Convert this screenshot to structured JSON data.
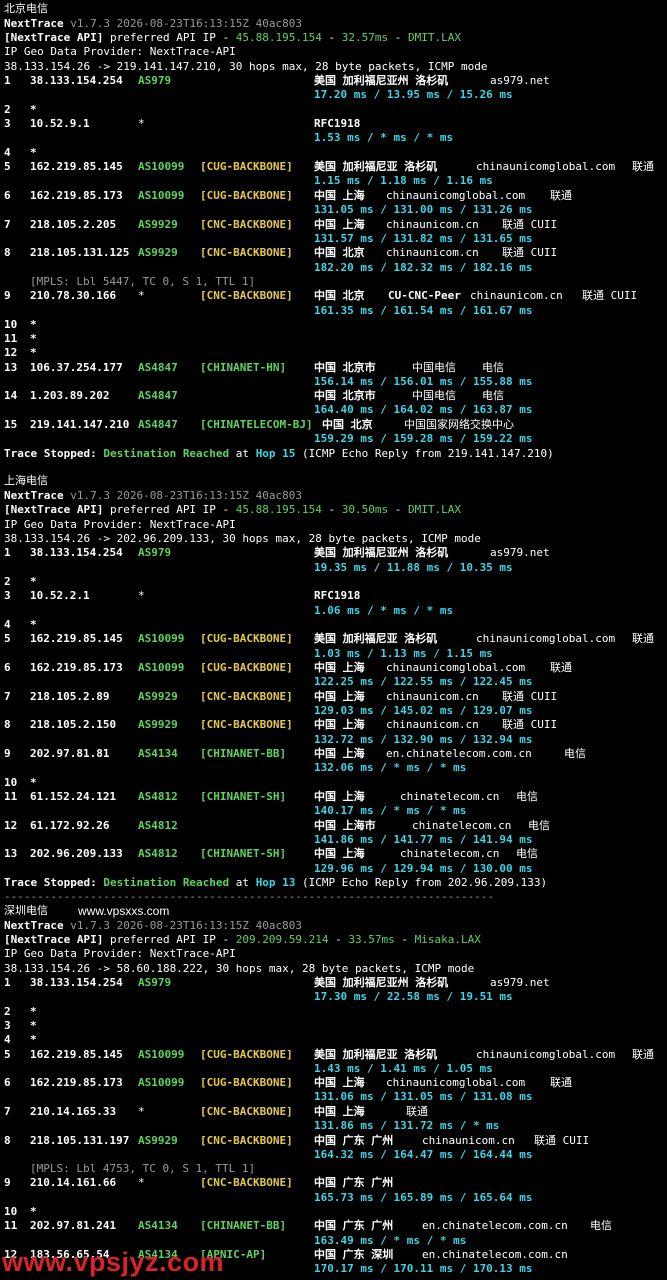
{
  "colors": {
    "background": "#000000",
    "white": "#ffffff",
    "gray": "#9a9a9a",
    "green": "#5fd35f",
    "yellow": "#e5c94a",
    "cyan": "#3fd4e6",
    "watermark": "#d9232a"
  },
  "s1": {
    "title": "北京电信",
    "app": "NextTrace",
    "version": "v1.7.3 2026-08-23T16:13:15Z 40ac803",
    "api_prefix": "[NextTrace API]",
    "api_mid": " preferred API IP - ",
    "api_ip": "45.88.195.154",
    "api_dash": " - ",
    "api_ms": "32.57ms",
    "api_dash2": " - ",
    "api_node": "DMIT.LAX",
    "geo": "IP Geo Data Provider: NextTrace-API",
    "route": "38.133.154.26 -> 219.141.147.210, 30 hops max, 28 byte packets, ICMP mode",
    "h1": {
      "n": "1",
      "ip": "38.133.154.254",
      "as": "AS979",
      "geo": "美国 加利福尼亚州 洛杉矶",
      "dom": "as979.net",
      "rtt": "17.20 ms / 13.95 ms / 15.26 ms"
    },
    "h2": {
      "n": "2",
      "ip": "*"
    },
    "h3": {
      "n": "3",
      "ip": "10.52.9.1",
      "as": "*",
      "geo": "RFC1918",
      "rtt": "1.53 ms / * ms / * ms"
    },
    "h4": {
      "n": "4",
      "ip": "*"
    },
    "h5": {
      "n": "5",
      "ip": "162.219.85.145",
      "as": "AS10099",
      "tag": "[CUG-BACKBONE]",
      "geo": "美国 加利福尼亚 洛杉矶",
      "dom": "chinaunicomglobal.com",
      "isp": "联通",
      "rtt": "1.15 ms / 1.18 ms / 1.16 ms"
    },
    "h6": {
      "n": "6",
      "ip": "162.219.85.173",
      "as": "AS10099",
      "tag": "[CUG-BACKBONE]",
      "geo": "中国 上海",
      "dom": "chinaunicomglobal.com",
      "isp": "联通",
      "rtt": "131.05 ms / 131.00 ms / 131.26 ms"
    },
    "h7": {
      "n": "7",
      "ip": "218.105.2.205",
      "as": "AS9929",
      "tag": "[CNC-BACKBONE]",
      "geo": "中国 上海",
      "dom": "chinaunicom.cn",
      "isp": "联通 CUII",
      "rtt": "131.57 ms / 131.82 ms / 131.65 ms"
    },
    "h8": {
      "n": "8",
      "ip": "218.105.131.125",
      "as": "AS9929",
      "tag": "[CNC-BACKBONE]",
      "geo": "中国 北京",
      "dom": "chinaunicom.cn",
      "isp": "联通 CUII",
      "rtt": "182.20 ms / 182.32 ms / 182.16 ms"
    },
    "mpls": "[MPLS: Lbl 5447, TC 0, S 1, TTL 1]",
    "h9": {
      "n": "9",
      "ip": "210.78.30.166",
      "as": "*",
      "tag": "[CNC-BACKBONE]",
      "geo": "中国 北京",
      "extra": "CU-CNC-Peer",
      "dom": "chinaunicom.cn",
      "isp": "联通 CUII",
      "rtt": "161.35 ms / 161.54 ms / 161.67 ms"
    },
    "h10": {
      "n": "10",
      "ip": "*"
    },
    "h11": {
      "n": "11",
      "ip": "*"
    },
    "h12": {
      "n": "12",
      "ip": "*"
    },
    "h13": {
      "n": "13",
      "ip": "106.37.254.177",
      "as": "AS4847",
      "tag": "[CHINANET-HN]",
      "geo": "中国 北京市",
      "dom": "中国电信",
      "isp": "电信",
      "rtt": "156.14 ms / 156.01 ms / 155.88 ms"
    },
    "h14": {
      "n": "14",
      "ip": "1.203.89.202",
      "as": "AS4847",
      "geo": "中国 北京市",
      "dom": "中国电信",
      "isp": "电信",
      "rtt": "164.40 ms / 164.02 ms / 163.87 ms"
    },
    "h15": {
      "n": "15",
      "ip": "219.141.147.210",
      "as": "AS4847",
      "tag": "[CHINATELECOM-BJ]",
      "geo": "中国 北京",
      "dom": "中国国家网络交换中心",
      "rtt": "159.29 ms / 159.28 ms / 159.22 ms"
    },
    "stop1": "Trace Stopped: ",
    "stop2": "Destination Reached",
    "stop3": " at ",
    "stop4": "Hop 15",
    "stop5": " (ICMP Echo Reply from 219.141.147.210)"
  },
  "s2": {
    "title": "上海电信",
    "app": "NextTrace",
    "version": "v1.7.3 2026-08-23T16:13:15Z 40ac803",
    "api_prefix": "[NextTrace API]",
    "api_mid": " preferred API IP - ",
    "api_ip": "45.88.195.154",
    "api_dash": " - ",
    "api_ms": "30.50ms",
    "api_dash2": " - ",
    "api_node": "DMIT.LAX",
    "geo": "IP Geo Data Provider: NextTrace-API",
    "route": "38.133.154.26 -> 202.96.209.133, 30 hops max, 28 byte packets, ICMP mode",
    "h1": {
      "n": "1",
      "ip": "38.133.154.254",
      "as": "AS979",
      "geo": "美国 加利福尼亚州 洛杉矶",
      "dom": "as979.net",
      "rtt": "19.35 ms / 11.88 ms / 10.35 ms"
    },
    "h2": {
      "n": "2",
      "ip": "*"
    },
    "h3": {
      "n": "3",
      "ip": "10.52.2.1",
      "as": "*",
      "geo": "RFC1918",
      "rtt": "1.06 ms / * ms / * ms"
    },
    "h4": {
      "n": "4",
      "ip": "*"
    },
    "h5": {
      "n": "5",
      "ip": "162.219.85.145",
      "as": "AS10099",
      "tag": "[CUG-BACKBONE]",
      "geo": "美国 加利福尼亚 洛杉矶",
      "dom": "chinaunicomglobal.com",
      "isp": "联通",
      "rtt": "1.03 ms / 1.13 ms / 1.15 ms"
    },
    "h6": {
      "n": "6",
      "ip": "162.219.85.173",
      "as": "AS10099",
      "tag": "[CUG-BACKBONE]",
      "geo": "中国 上海",
      "dom": "chinaunicomglobal.com",
      "isp": "联通",
      "rtt": "122.25 ms / 122.55 ms / 122.45 ms"
    },
    "h7": {
      "n": "7",
      "ip": "218.105.2.89",
      "as": "AS9929",
      "tag": "[CNC-BACKBONE]",
      "geo": "中国 上海",
      "dom": "chinaunicom.cn",
      "isp": "联通 CUII",
      "rtt": "129.03 ms / 145.02 ms / 129.07 ms"
    },
    "h8": {
      "n": "8",
      "ip": "218.105.2.150",
      "as": "AS9929",
      "tag": "[CNC-BACKBONE]",
      "geo": "中国 上海",
      "dom": "chinaunicom.cn",
      "isp": "联通 CUII",
      "rtt": "132.72 ms / 132.90 ms / 132.94 ms"
    },
    "h9": {
      "n": "9",
      "ip": "202.97.81.81",
      "as": "AS4134",
      "tag": "[CHINANET-BB]",
      "geo": "中国 上海",
      "dom": "en.chinatelecom.com.cn",
      "isp": "电信",
      "rtt": "132.06 ms / * ms / * ms"
    },
    "h10": {
      "n": "10",
      "ip": "*"
    },
    "h11": {
      "n": "11",
      "ip": "61.152.24.121",
      "as": "AS4812",
      "tag": "[CHINANET-SH]",
      "geo": "中国 上海",
      "dom": "chinatelecom.cn",
      "isp": "电信",
      "rtt": "140.17 ms / * ms / * ms"
    },
    "h12": {
      "n": "12",
      "ip": "61.172.92.26",
      "as": "AS4812",
      "geo": "中国 上海市",
      "dom": "chinatelecom.cn",
      "isp": "电信",
      "rtt": "141.86 ms / 141.77 ms / 141.94 ms"
    },
    "h13": {
      "n": "13",
      "ip": "202.96.209.133",
      "as": "AS4812",
      "tag": "[CHINANET-SH]",
      "geo": "中国 上海",
      "dom": "chinatelecom.cn",
      "isp": "电信",
      "rtt": "129.96 ms / 129.94 ms / 130.00 ms"
    },
    "stop1": "Trace Stopped: ",
    "stop2": "Destination Reached",
    "stop3": " at ",
    "stop4": "Hop 13",
    "stop5": " (ICMP Echo Reply from 202.96.209.133)"
  },
  "divider": "--------------------------------------------------------------------------",
  "s3": {
    "title": "深圳电信",
    "site": "www.vpsxxs.com",
    "app": "NextTrace",
    "version": "v1.7.3 2026-08-23T16:13:15Z 40ac803",
    "api_prefix": "[NextTrace API]",
    "api_mid": " preferred API IP - ",
    "api_ip": "209.209.59.214",
    "api_dash": " - ",
    "api_ms": "33.57ms",
    "api_dash2": " - ",
    "api_node": "Misaka.LAX",
    "geo": "IP Geo Data Provider: NextTrace-API",
    "route": "38.133.154.26 -> 58.60.188.222, 30 hops max, 28 byte packets, ICMP mode",
    "h1": {
      "n": "1",
      "ip": "38.133.154.254",
      "as": "AS979",
      "geo": "美国 加利福尼亚州 洛杉矶",
      "dom": "as979.net",
      "rtt": "17.30 ms / 22.58 ms / 19.51 ms"
    },
    "h2": {
      "n": "2",
      "ip": "*"
    },
    "h3": {
      "n": "3",
      "ip": "*"
    },
    "h4": {
      "n": "4",
      "ip": "*"
    },
    "h5": {
      "n": "5",
      "ip": "162.219.85.145",
      "as": "AS10099",
      "tag": "[CUG-BACKBONE]",
      "geo": "美国 加利福尼亚 洛杉矶",
      "dom": "chinaunicomglobal.com",
      "isp": "联通",
      "rtt": "1.43 ms / 1.41 ms / 1.05 ms"
    },
    "h6": {
      "n": "6",
      "ip": "162.219.85.173",
      "as": "AS10099",
      "tag": "[CUG-BACKBONE]",
      "geo": "中国 上海",
      "dom": "chinaunicomglobal.com",
      "isp": "联通",
      "rtt": "131.06 ms / 131.05 ms / 131.08 ms"
    },
    "h7": {
      "n": "7",
      "ip": "210.14.165.33",
      "as": "*",
      "tag": "[CNC-BACKBONE]",
      "geo": "中国 上海",
      "isp": "联通",
      "rtt": "131.86 ms / 131.72 ms / * ms"
    },
    "h8": {
      "n": "8",
      "ip": "218.105.131.197",
      "as": "AS9929",
      "tag": "[CNC-BACKBONE]",
      "geo": "中国 广东 广州",
      "dom": "chinaunicom.cn",
      "isp": "联通 CUII",
      "rtt": "164.32 ms / 164.47 ms / 164.44 ms"
    },
    "mpls": "[MPLS: Lbl 4753, TC 0, S 1, TTL 1]",
    "h9": {
      "n": "9",
      "ip": "210.14.161.66",
      "as": "*",
      "tag": "[CNC-BACKBONE]",
      "geo": "中国 广东 广州",
      "rtt": "165.73 ms / 165.89 ms / 165.64 ms"
    },
    "h10": {
      "n": "10",
      "ip": "*"
    },
    "h11": {
      "n": "11",
      "ip": "202.97.81.241",
      "as": "AS4134",
      "tag": "[CHINANET-BB]",
      "geo": "中国 广东 广州",
      "dom": "en.chinatelecom.com.cn",
      "isp": "电信",
      "rtt": "163.49 ms / * ms / * ms"
    },
    "h12": {
      "n": "12",
      "ip": "183.56.65.54",
      "as": "AS4134",
      "tag": "[APNIC-AP]",
      "geo": "中国 广东 深圳",
      "dom": "en.chinatelecom.com.cn",
      "rtt": "170.17 ms / 170.11 ms / 170.13 ms"
    }
  },
  "watermark": "www.vpsjyz.com"
}
